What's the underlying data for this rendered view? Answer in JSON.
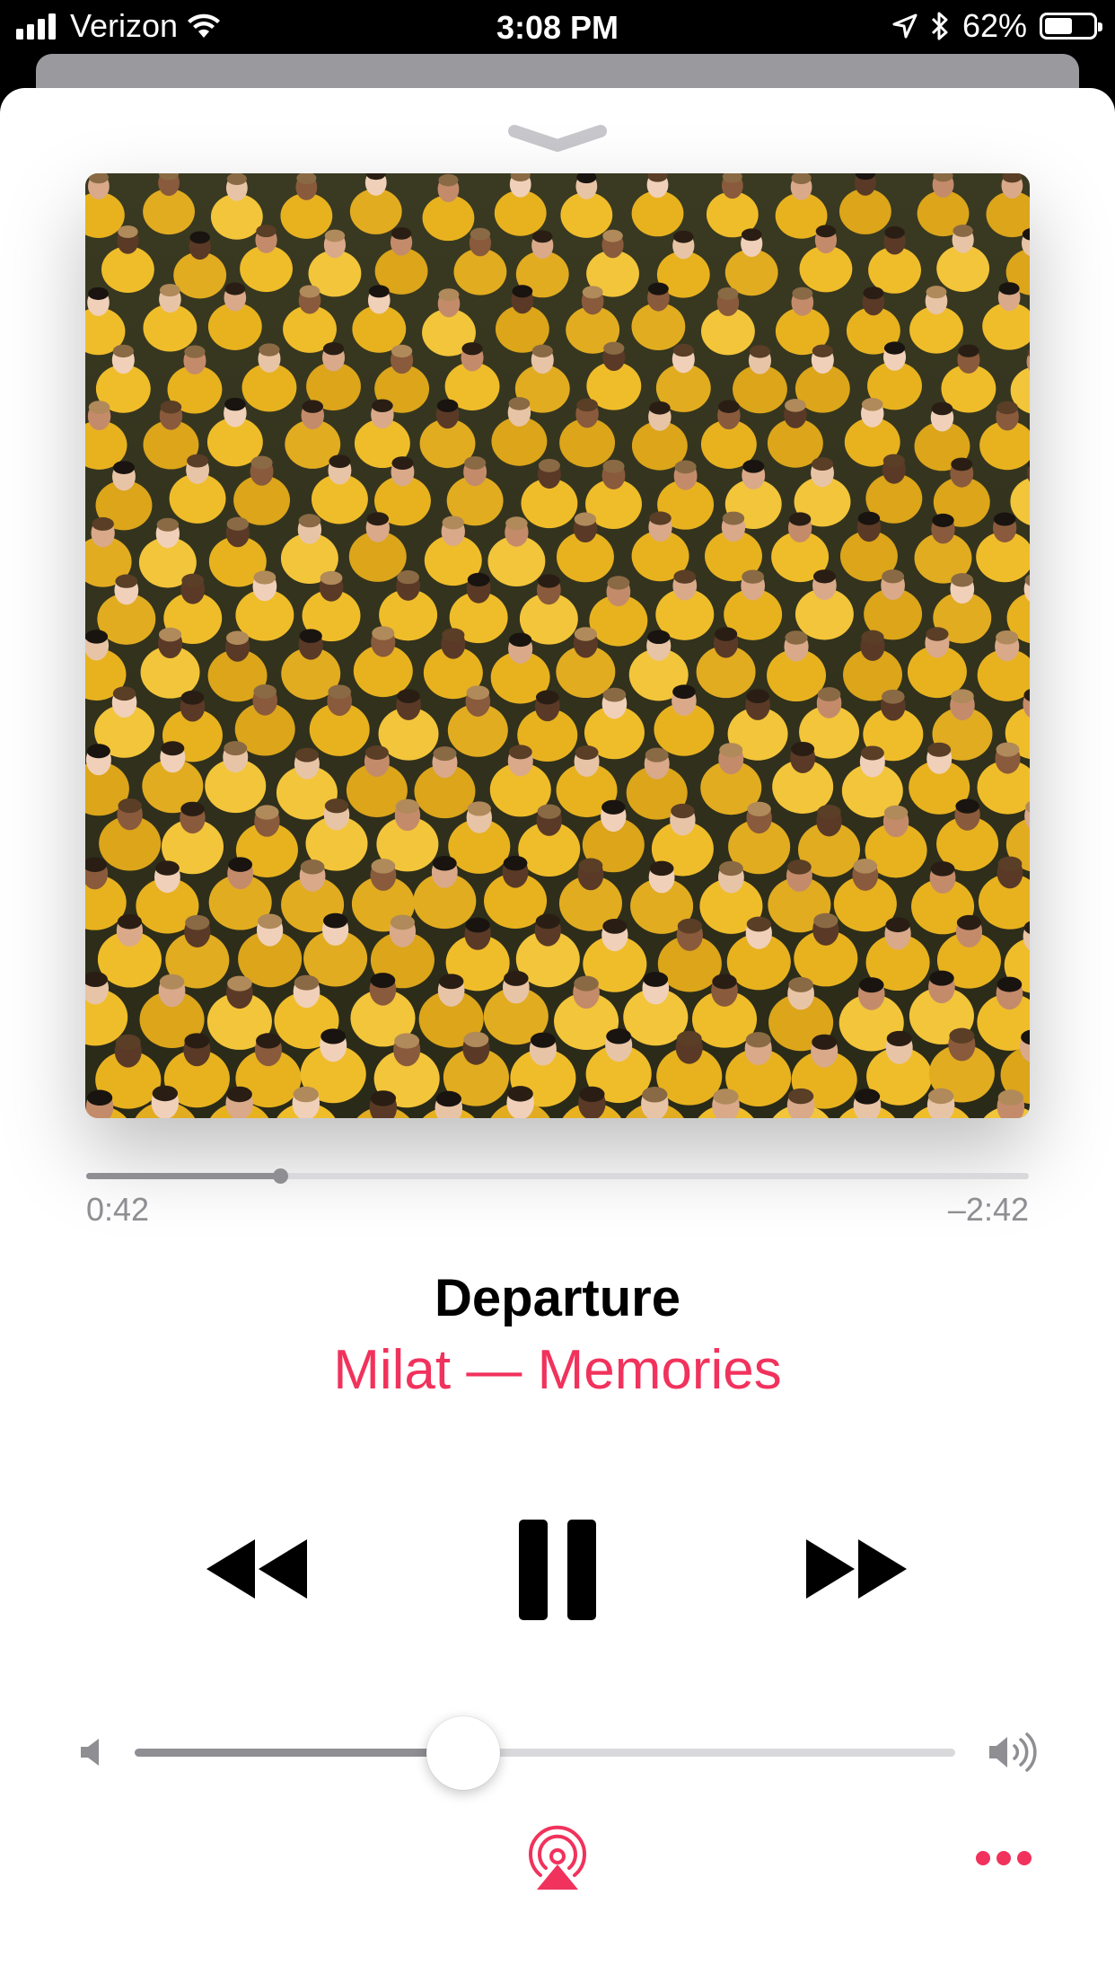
{
  "status_bar": {
    "carrier": "Verizon",
    "time": "3:08 PM",
    "battery_percent": "62%",
    "battery_level": 0.62
  },
  "player": {
    "song_title": "Departure",
    "artist_album": "Milat — Memories",
    "elapsed": "0:42",
    "remaining": "–2:42",
    "progress_fraction": 0.206,
    "volume_fraction": 0.4,
    "accent_color": "#f1325c"
  },
  "icons": {
    "signal": "cellular-signal-icon",
    "wifi": "wifi-icon",
    "location": "location-arrow-icon",
    "bluetooth": "bluetooth-icon",
    "battery": "battery-icon",
    "grabber": "chevron-down-icon",
    "rewind": "rewind-icon",
    "pause": "pause-icon",
    "forward": "fast-forward-icon",
    "volume_min": "speaker-icon",
    "volume_max": "speaker-loud-icon",
    "airplay": "airplay-icon",
    "more": "more-ellipsis-icon"
  }
}
